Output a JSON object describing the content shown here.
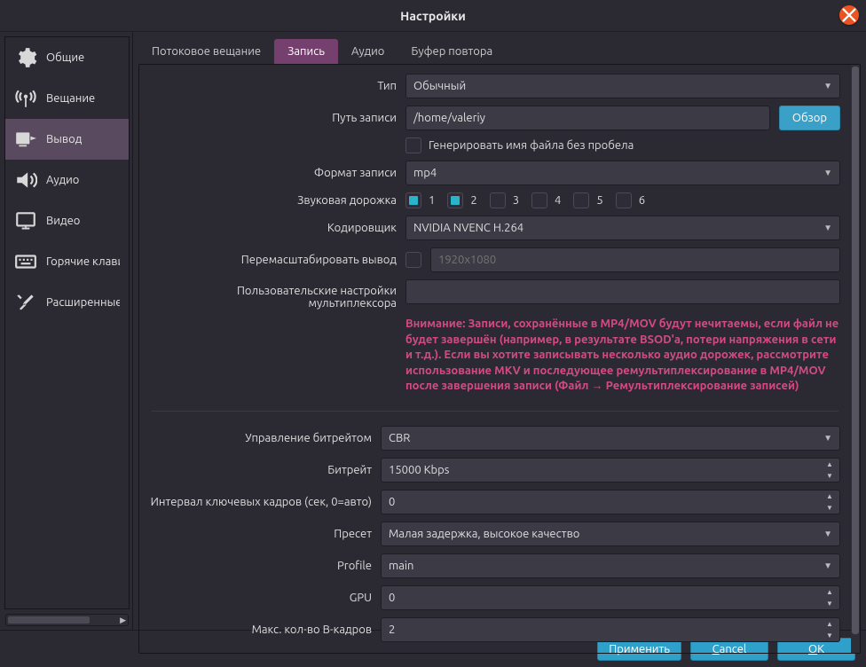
{
  "titlebar": {
    "title": "Настройки"
  },
  "sidebar": {
    "items": [
      {
        "label": "Общие"
      },
      {
        "label": "Вещание"
      },
      {
        "label": "Вывод"
      },
      {
        "label": "Аудио"
      },
      {
        "label": "Видео"
      },
      {
        "label": "Горячие клавиши"
      },
      {
        "label": "Расширенные"
      }
    ]
  },
  "tabs": [
    {
      "label": "Потоковое вещание"
    },
    {
      "label": "Запись"
    },
    {
      "label": "Аудио"
    },
    {
      "label": "Буфер повтора"
    }
  ],
  "labels": {
    "type": "Тип",
    "path": "Путь записи",
    "gename": "Генерировать имя файла без пробела",
    "format": "Формат записи",
    "track": "Звуковая дорожка",
    "encoder": "Кодировщик",
    "rescale": "Перемасштабировать вывод",
    "muxer": "Пользовательские настройки мультиплексора",
    "ratectrl": "Управление битрейтом",
    "bitrate": "Битрейт",
    "keyint": "Интервал ключевых кадров (сек, 0=авто)",
    "preset": "Пресет",
    "profile": "Profile",
    "gpu": "GPU",
    "bframes": "Макс. кол-во B-кадров"
  },
  "values": {
    "type": "Обычный",
    "path": "/home/valeriy",
    "browse": "Обзор",
    "format": "mp4",
    "tracks": [
      "1",
      "2",
      "3",
      "4",
      "5",
      "6"
    ],
    "encoder": "NVIDIA NVENC H.264",
    "rescale_placeholder": "1920x1080",
    "ratectrl": "CBR",
    "bitrate": "15000 Kbps",
    "keyint": "0",
    "preset": "Малая задержка, высокое качество",
    "profile": "main",
    "gpu": "0",
    "bframes": "2"
  },
  "warning": "Внимание: Записи, сохранённые в MP4/MOV будут нечитаемы, если файл не будет завершён (например, в результате BSOD'a, потери напряжения в сети и т.д.). Если вы хотите записывать несколько аудио дорожек, рассмотрите использование MKV и последующее ремультиплексирование в MP4/MOV после завершения записи (Файл → Ремультиплексирование записей)",
  "footer": {
    "apply": "Применить",
    "cancel_pre": "",
    "cancel_u": "C",
    "cancel_post": "ancel",
    "ok_pre": "",
    "ok_u": "O",
    "ok_post": "K"
  }
}
